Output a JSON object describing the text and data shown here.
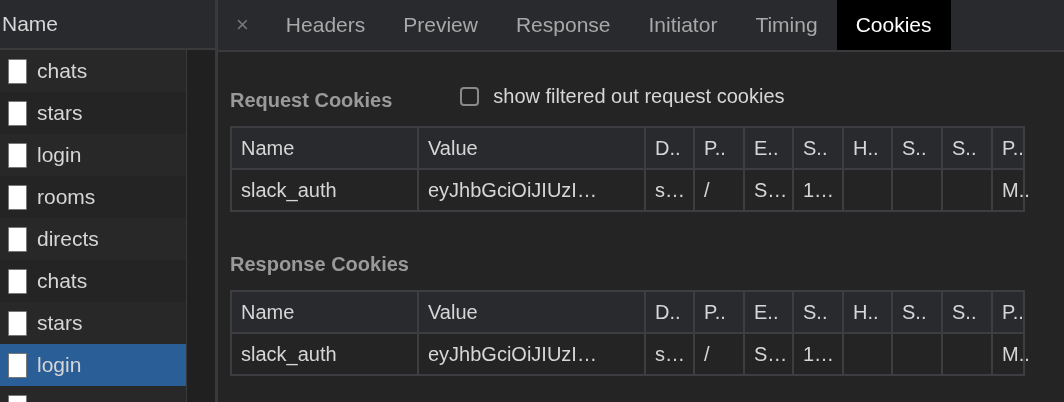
{
  "request_list": {
    "header": "Name",
    "items": [
      {
        "name": "chats",
        "selected": false
      },
      {
        "name": "stars",
        "selected": false
      },
      {
        "name": "login",
        "selected": false
      },
      {
        "name": "rooms",
        "selected": false
      },
      {
        "name": "directs",
        "selected": false
      },
      {
        "name": "chats",
        "selected": false
      },
      {
        "name": "stars",
        "selected": false
      },
      {
        "name": "login",
        "selected": true
      }
    ]
  },
  "detail_tabs": {
    "close": "×",
    "tabs": [
      {
        "label": "Headers",
        "selected": false
      },
      {
        "label": "Preview",
        "selected": false
      },
      {
        "label": "Response",
        "selected": false
      },
      {
        "label": "Initiator",
        "selected": false
      },
      {
        "label": "Timing",
        "selected": false
      },
      {
        "label": "Cookies",
        "selected": true
      }
    ]
  },
  "sections": [
    {
      "title": "Request Cookies",
      "filter_checkbox": {
        "label": "show filtered out request cookies",
        "checked": false
      },
      "columns": [
        "Name",
        "Value",
        "D..",
        "P..",
        "E..",
        "S..",
        "H..",
        "S..",
        "S..",
        "P.."
      ],
      "rows": [
        [
          "slack_auth",
          "eyJhbGciOiJIUzI…",
          "s…",
          "/",
          "S…",
          "1…",
          null,
          null,
          null,
          "M.."
        ]
      ]
    },
    {
      "title": "Response Cookies",
      "columns": [
        "Name",
        "Value",
        "D..",
        "P..",
        "E..",
        "S..",
        "H..",
        "S..",
        "S..",
        "P.."
      ],
      "rows": [
        [
          "slack_auth",
          "eyJhbGciOiJIUzI…",
          "s…",
          "/",
          "S…",
          "1…",
          null,
          null,
          null,
          "M.."
        ]
      ]
    }
  ]
}
